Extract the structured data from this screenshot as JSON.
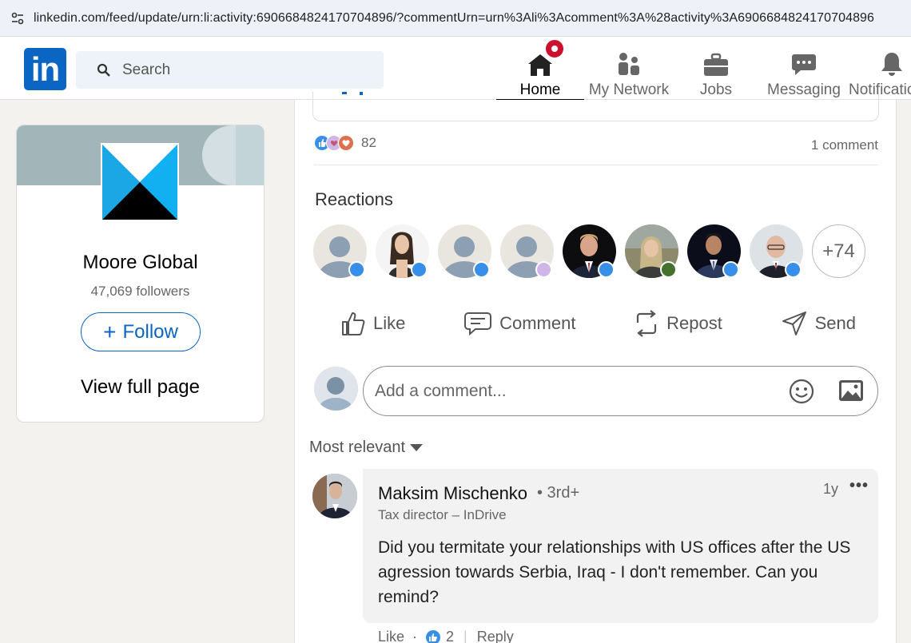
{
  "browser": {
    "url": "linkedin.com/feed/update/urn:li:activity:6906684824170704896/?commentUrn=urn%3Ali%3Acomment%3A%28activity%3A6906684824170704896"
  },
  "nav": {
    "logo_text": "in",
    "search_placeholder": "Search",
    "items": [
      {
        "label": "Home",
        "icon": "home-icon",
        "active": true
      },
      {
        "label": "My Network",
        "icon": "network-icon"
      },
      {
        "label": "Jobs",
        "icon": "briefcase-icon"
      },
      {
        "label": "Messaging",
        "icon": "chat-icon"
      },
      {
        "label": "Notifications",
        "icon": "bell-icon"
      }
    ],
    "brand_color": "#0a66c2"
  },
  "company": {
    "name": "Moore Global",
    "followers": "47,069 followers",
    "follow_label": "Follow",
    "view_full_page": "View full page"
  },
  "post": {
    "reactions_count": "82",
    "comments_count": "1 comment",
    "reactions_title": "Reactions",
    "more_reactors": "+74",
    "actions": {
      "like": "Like",
      "comment": "Comment",
      "repost": "Repost",
      "send": "Send"
    },
    "comment_placeholder": "Add a comment...",
    "sort_label": "Most relevant"
  },
  "comment": {
    "author": "Maksim Mischenko",
    "degree": "• 3rd+",
    "headline": "Tax director – InDrive",
    "time": "1y",
    "text": "Did you termitate your relationships with US offices after the US agression towards Serbia, Iraq - I don't remember. Can you remind?",
    "like_label": "Like",
    "like_count": "2",
    "reply_label": "Reply"
  }
}
